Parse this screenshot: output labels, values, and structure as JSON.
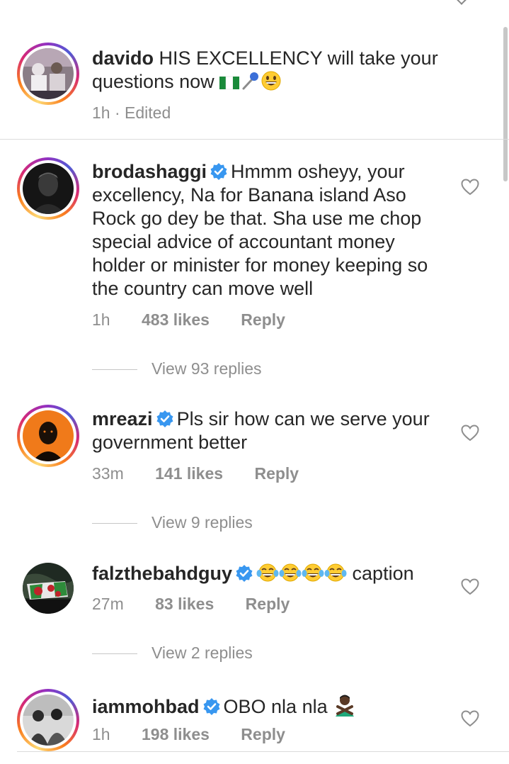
{
  "caption": {
    "username": "davido",
    "text": "HIS EXCELLENCY will take your questions now",
    "emojis": [
      "nigeria-flag-icon",
      "microphone-icon",
      "grinning-face-icon"
    ],
    "meta": "1h · Edited"
  },
  "comments": [
    {
      "username": "brodashaggi",
      "verified": true,
      "text": "Hmmm osheyy, your excellency, Na for Banana island Aso Rock go dey be that. Sha use me chop special advice of accountant money holder or minister for money keeping so the country can move well",
      "time": "1h",
      "likes": "483 likes",
      "reply": "Reply",
      "view_replies": "View 93 replies"
    },
    {
      "username": "mreazi",
      "verified": true,
      "text": "Pls sir how can we serve your government better",
      "time": "33m",
      "likes": "141 likes",
      "reply": "Reply",
      "view_replies": "View 9 replies"
    },
    {
      "username": "falzthebahdguy",
      "verified": true,
      "text": "caption",
      "emojis": [
        "face-with-tears-of-joy-icon",
        "face-with-tears-of-joy-icon",
        "face-with-tears-of-joy-icon",
        "face-with-tears-of-joy-icon"
      ],
      "time": "27m",
      "likes": "83 likes",
      "reply": "Reply",
      "view_replies": "View 2 replies"
    },
    {
      "username": "iammohbad",
      "verified": true,
      "text": "OBO nla nla",
      "emojis": [
        "person-gesturing-no-icon"
      ],
      "time": "1h",
      "likes": "198 likes",
      "reply": "Reply"
    }
  ],
  "colors": {
    "text": "#262626",
    "secondary": "#8e8e8e",
    "verified_blue": "#3897f0",
    "divider": "#dbdbdb"
  }
}
